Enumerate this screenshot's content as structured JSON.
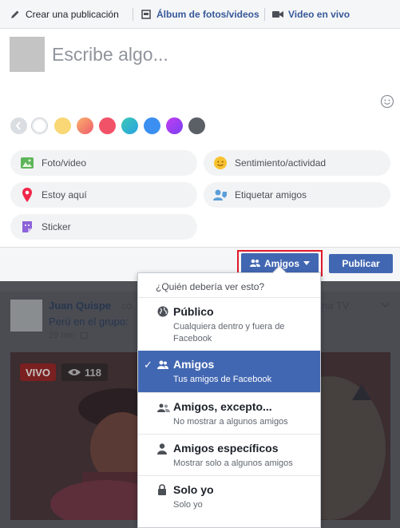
{
  "composer": {
    "tabs": [
      {
        "label": "Crear una publicación",
        "icon": "pencil-icon"
      },
      {
        "label": "Álbum de fotos/videos",
        "icon": "photo-album-icon"
      },
      {
        "label": "Video en vivo",
        "icon": "video-camera-icon"
      }
    ],
    "placeholder": "Escribe algo...",
    "background_swatches": [
      "#ffffff",
      "#f8d774",
      "#f47e5a",
      "#f25268",
      "#3cc8b4",
      "#3b8ff1",
      "#a13ef2",
      "#5b5f66"
    ],
    "actions": [
      {
        "label": "Foto/video",
        "icon": "photo-icon"
      },
      {
        "label": "Sentimiento/actividad",
        "icon": "smiley-icon"
      },
      {
        "label": "Estoy aquí",
        "icon": "location-pin-icon"
      },
      {
        "label": "Etiquetar amigos",
        "icon": "tag-friends-icon"
      },
      {
        "label": "Sticker",
        "icon": "sticker-icon"
      }
    ],
    "audience_label": "Amigos",
    "publish_label": "Publicar"
  },
  "feed_post": {
    "author": "Juan Quispe",
    "author_suffix": "co",
    "author_suffix2": "na TV",
    "group_line": "Perú en el grupo:",
    "time": "29 min",
    "live_badge": "VIVO",
    "viewers": "118"
  },
  "audience_menu": {
    "header": "¿Quién debería ver esto?",
    "options": [
      {
        "title": "Público",
        "desc": "Cualquiera dentro y fuera de Facebook",
        "icon": "globe-icon",
        "selected": false
      },
      {
        "title": "Amigos",
        "desc": "Tus amigos de Facebook",
        "icon": "friends-icon",
        "selected": true
      },
      {
        "title": "Amigos, excepto...",
        "desc": "No mostrar a algunos amigos",
        "icon": "friends-except-icon",
        "selected": false
      },
      {
        "title": "Amigos específicos",
        "desc": "Mostrar solo a algunos amigos",
        "icon": "person-icon",
        "selected": false
      },
      {
        "title": "Solo yo",
        "desc": "Solo yo",
        "icon": "lock-icon",
        "selected": false
      }
    ]
  },
  "colors": {
    "accent": "#4267b2",
    "highlight": "#e0192a",
    "link": "#365899"
  }
}
